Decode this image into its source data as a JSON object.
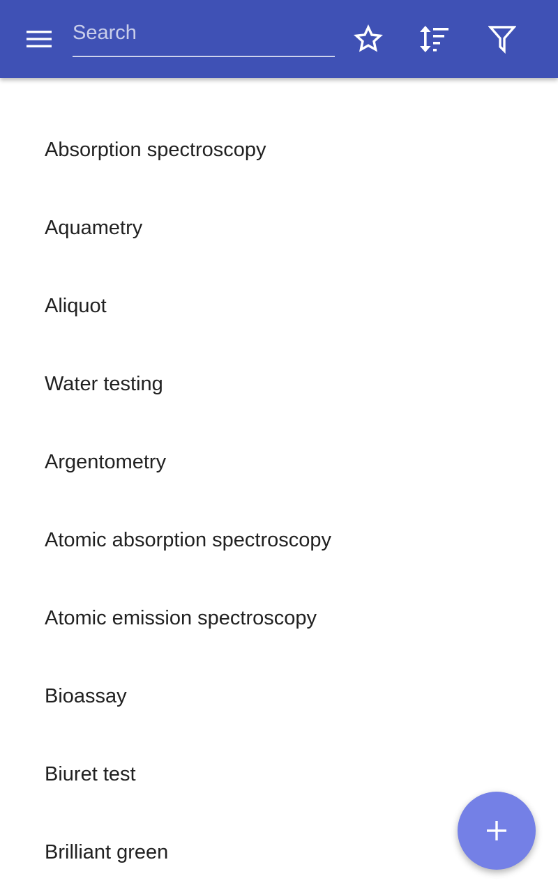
{
  "colors": {
    "toolbar": "#3f51b5",
    "fab": "#7480e6",
    "text": "#212121",
    "background": "#ffffff"
  },
  "toolbar": {
    "menu_icon": "menu-icon",
    "search_placeholder": "Search",
    "search_value": "",
    "actions": [
      "star-outline-icon",
      "sort-icon",
      "filter-icon"
    ]
  },
  "list": {
    "items": [
      {
        "label": "Absorption spectroscopy"
      },
      {
        "label": "Aquametry"
      },
      {
        "label": "Aliquot"
      },
      {
        "label": "Water testing"
      },
      {
        "label": "Argentometry"
      },
      {
        "label": "Atomic absorption spectroscopy"
      },
      {
        "label": "Atomic emission spectroscopy"
      },
      {
        "label": "Bioassay"
      },
      {
        "label": "Biuret test"
      },
      {
        "label": "Brilliant green"
      }
    ]
  },
  "fab": {
    "icon": "plus-icon"
  }
}
